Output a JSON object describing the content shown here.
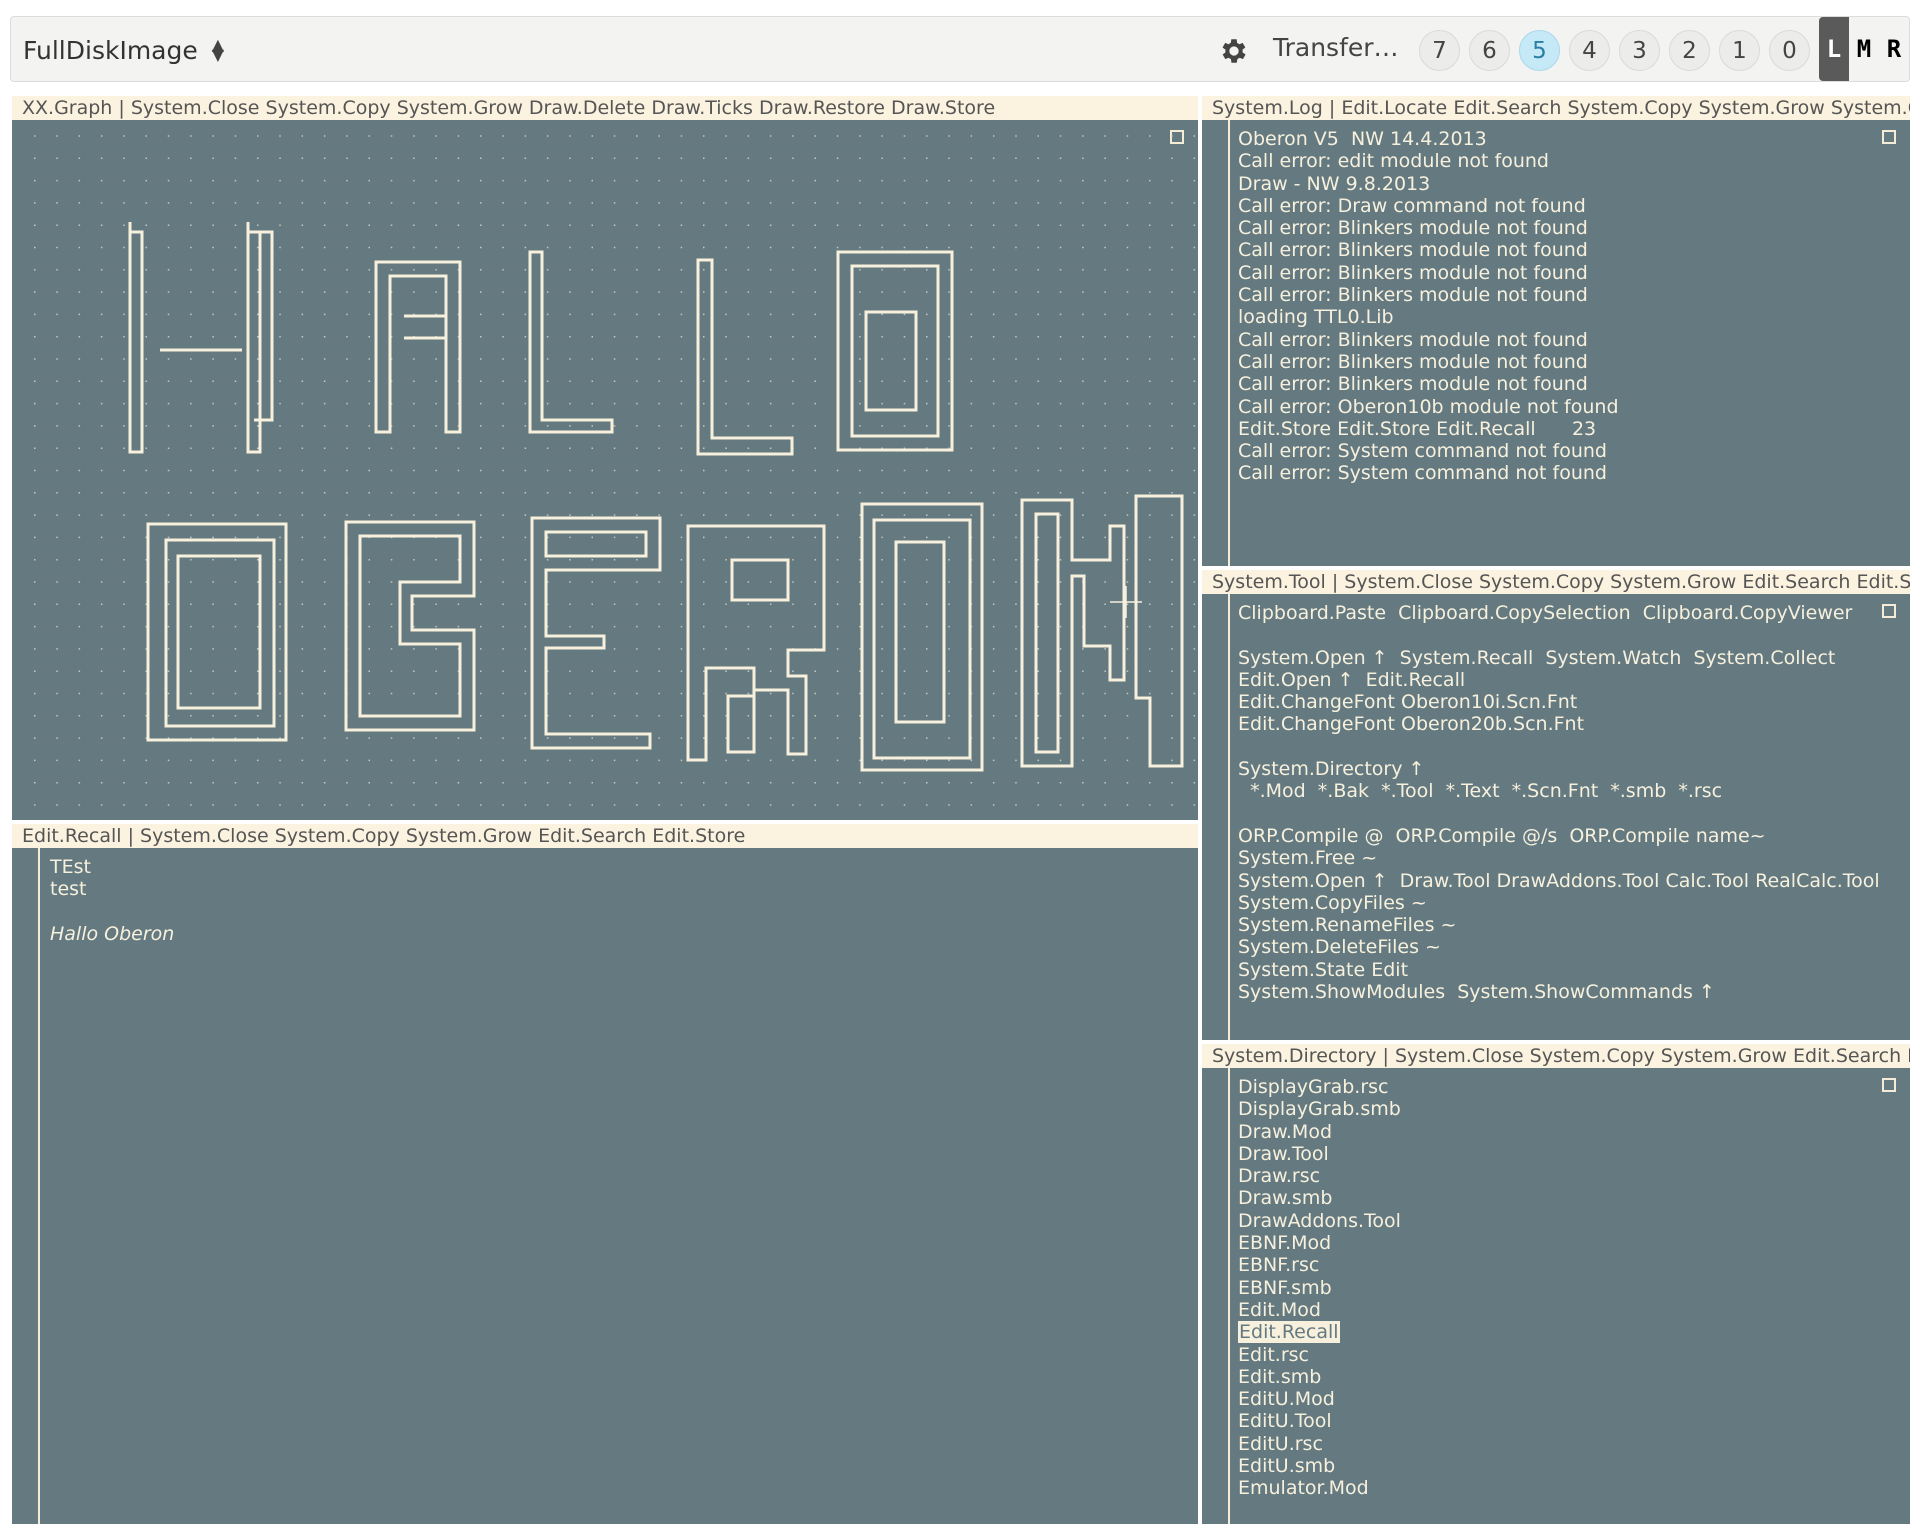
{
  "toolbar": {
    "disk_image": "FullDiskImage",
    "transfer_label": "Transfer…",
    "clock_buttons": [
      "7",
      "6",
      "5",
      "4",
      "3",
      "2",
      "1",
      "0"
    ],
    "active_clock": "5",
    "mouse_buttons": [
      "L",
      "M",
      "R"
    ],
    "active_mouse": "L"
  },
  "graph_viewer": {
    "title": {
      "name": "XX.Graph",
      "commands": [
        "System.Close",
        "System.Copy",
        "System.Grow",
        "Draw.Delete",
        "Draw.Ticks",
        "Draw.Restore",
        "Draw.Store"
      ]
    }
  },
  "recall_viewer": {
    "title": {
      "name": "Edit.Recall",
      "commands": [
        "System.Close",
        "System.Copy",
        "System.Grow",
        "Edit.Search",
        "Edit.Store"
      ]
    },
    "lines": [
      "TEst",
      "test",
      "",
      "Hallo Oberon"
    ]
  },
  "log_viewer": {
    "title": {
      "name": "System.Log",
      "commands": [
        "Edit.Locate",
        "Edit.Search",
        "System.Copy",
        "System.Grow",
        "System.Clear"
      ]
    },
    "lines": [
      "Oberon V5  NW 14.4.2013",
      "Call error: edit module not found",
      "Draw - NW 9.8.2013",
      "Call error: Draw command not found",
      "Call error: Blinkers module not found",
      "Call error: Blinkers module not found",
      "Call error: Blinkers module not found",
      "Call error: Blinkers module not found",
      "loading TTL0.Lib",
      "Call error: Blinkers module not found",
      "Call error: Blinkers module not found",
      "Call error: Blinkers module not found",
      "Call error: Oberon10b module not found",
      "Edit.Store Edit.Store Edit.Recall      23",
      "Call error: System command not found",
      "Call error: System command not found"
    ]
  },
  "tool_viewer": {
    "title": {
      "name": "System.Tool",
      "commands": [
        "System.Close",
        "System.Copy",
        "System.Grow",
        "Edit.Search",
        "Edit.Store"
      ]
    },
    "lines": [
      "Clipboard.Paste  Clipboard.CopySelection  Clipboard.CopyViewer",
      "",
      "System.Open ↑  System.Recall  System.Watch  System.Collect",
      "Edit.Open ↑  Edit.Recall",
      "Edit.ChangeFont Oberon10i.Scn.Fnt",
      "Edit.ChangeFont Oberon20b.Scn.Fnt",
      "",
      "System.Directory ↑",
      "  *.Mod  *.Bak  *.Tool  *.Text  *.Scn.Fnt  *.smb  *.rsc",
      "",
      "ORP.Compile @  ORP.Compile @/s  ORP.Compile name~",
      "System.Free ~",
      "System.Open ↑  Draw.Tool DrawAddons.Tool Calc.Tool RealCalc.Tool",
      "System.CopyFiles ~",
      "System.RenameFiles ~",
      "System.DeleteFiles ~",
      "System.State Edit",
      "System.ShowModules  System.ShowCommands ↑"
    ]
  },
  "dir_viewer": {
    "title": {
      "name": "System.Directory",
      "commands": [
        "System.Close",
        "System.Copy",
        "System.Grow",
        "Edit.Search",
        "Edit.St"
      ]
    },
    "lines": [
      "DisplayGrab.rsc",
      "DisplayGrab.smb",
      "Draw.Mod",
      "Draw.Tool",
      "Draw.rsc",
      "Draw.smb",
      "DrawAddons.Tool",
      "EBNF.Mod",
      "EBNF.rsc",
      "EBNF.smb",
      "Edit.Mod",
      "Edit.Recall",
      "Edit.rsc",
      "Edit.smb",
      "EditU.Mod",
      "EditU.Tool",
      "EditU.rsc",
      "EditU.smb",
      "Emulator.Mod"
    ],
    "selected": "Edit.Recall"
  }
}
